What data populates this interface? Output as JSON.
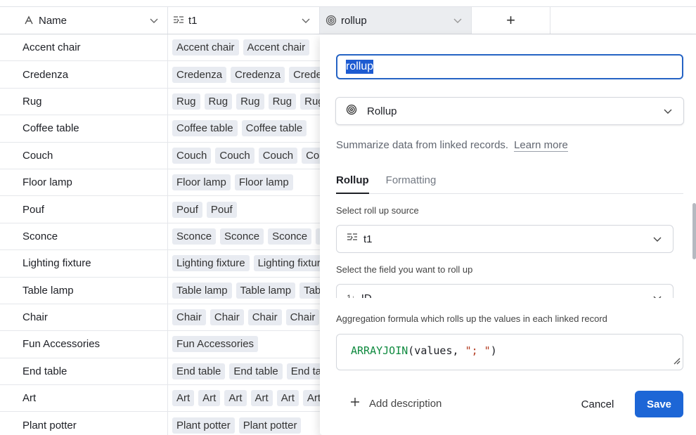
{
  "header": {
    "name_label": "Name",
    "t1_label": "t1",
    "rollup_label": "rollup",
    "add_label": "+"
  },
  "rows": [
    {
      "name": "Accent chair",
      "chips": [
        "Accent chair",
        "Accent chair"
      ]
    },
    {
      "name": "Credenza",
      "chips": [
        "Credenza",
        "Credenza",
        "Credenza"
      ]
    },
    {
      "name": "Rug",
      "chips": [
        "Rug",
        "Rug",
        "Rug",
        "Rug",
        "Rug"
      ]
    },
    {
      "name": "Coffee table",
      "chips": [
        "Coffee table",
        "Coffee table"
      ]
    },
    {
      "name": "Couch",
      "chips": [
        "Couch",
        "Couch",
        "Couch",
        "Couch"
      ]
    },
    {
      "name": "Floor lamp",
      "chips": [
        "Floor lamp",
        "Floor lamp"
      ]
    },
    {
      "name": "Pouf",
      "chips": [
        "Pouf",
        "Pouf"
      ]
    },
    {
      "name": "Sconce",
      "chips": [
        "Sconce",
        "Sconce",
        "Sconce",
        "Sconce"
      ]
    },
    {
      "name": "Lighting fixture",
      "chips": [
        "Lighting fixture",
        "Lighting fixture"
      ]
    },
    {
      "name": "Table lamp",
      "chips": [
        "Table lamp",
        "Table lamp",
        "Table lamp"
      ]
    },
    {
      "name": "Chair",
      "chips": [
        "Chair",
        "Chair",
        "Chair",
        "Chair"
      ]
    },
    {
      "name": "Fun Accessories",
      "chips": [
        "Fun Accessories"
      ]
    },
    {
      "name": "End table",
      "chips": [
        "End table",
        "End table",
        "End table"
      ]
    },
    {
      "name": "Art",
      "chips": [
        "Art",
        "Art",
        "Art",
        "Art",
        "Art",
        "Art"
      ]
    },
    {
      "name": "Plant potter",
      "chips": [
        "Plant potter",
        "Plant potter"
      ]
    }
  ],
  "panel": {
    "field_name": "rollup",
    "field_type": "Rollup",
    "description": "Summarize data from linked records.",
    "learn_more": "Learn more",
    "tabs": [
      "Rollup",
      "Formatting"
    ],
    "source_label": "Select roll up source",
    "source_value": "t1",
    "field_label": "Select the field you want to roll up",
    "field_value": "ID",
    "formula_label": "Aggregation formula which rolls up the values in each linked record",
    "formula_fn": "ARRAYJOIN",
    "formula_args_open": "(values, ",
    "formula_str": "\"; \"",
    "formula_close": ")",
    "add_description": "Add description",
    "cancel": "Cancel",
    "save": "Save"
  },
  "colors": {
    "accent": "#1d66d6",
    "chip_bg": "#e8ebf1",
    "formula_fn": "#0f8a3f",
    "formula_str": "#b33b20"
  }
}
